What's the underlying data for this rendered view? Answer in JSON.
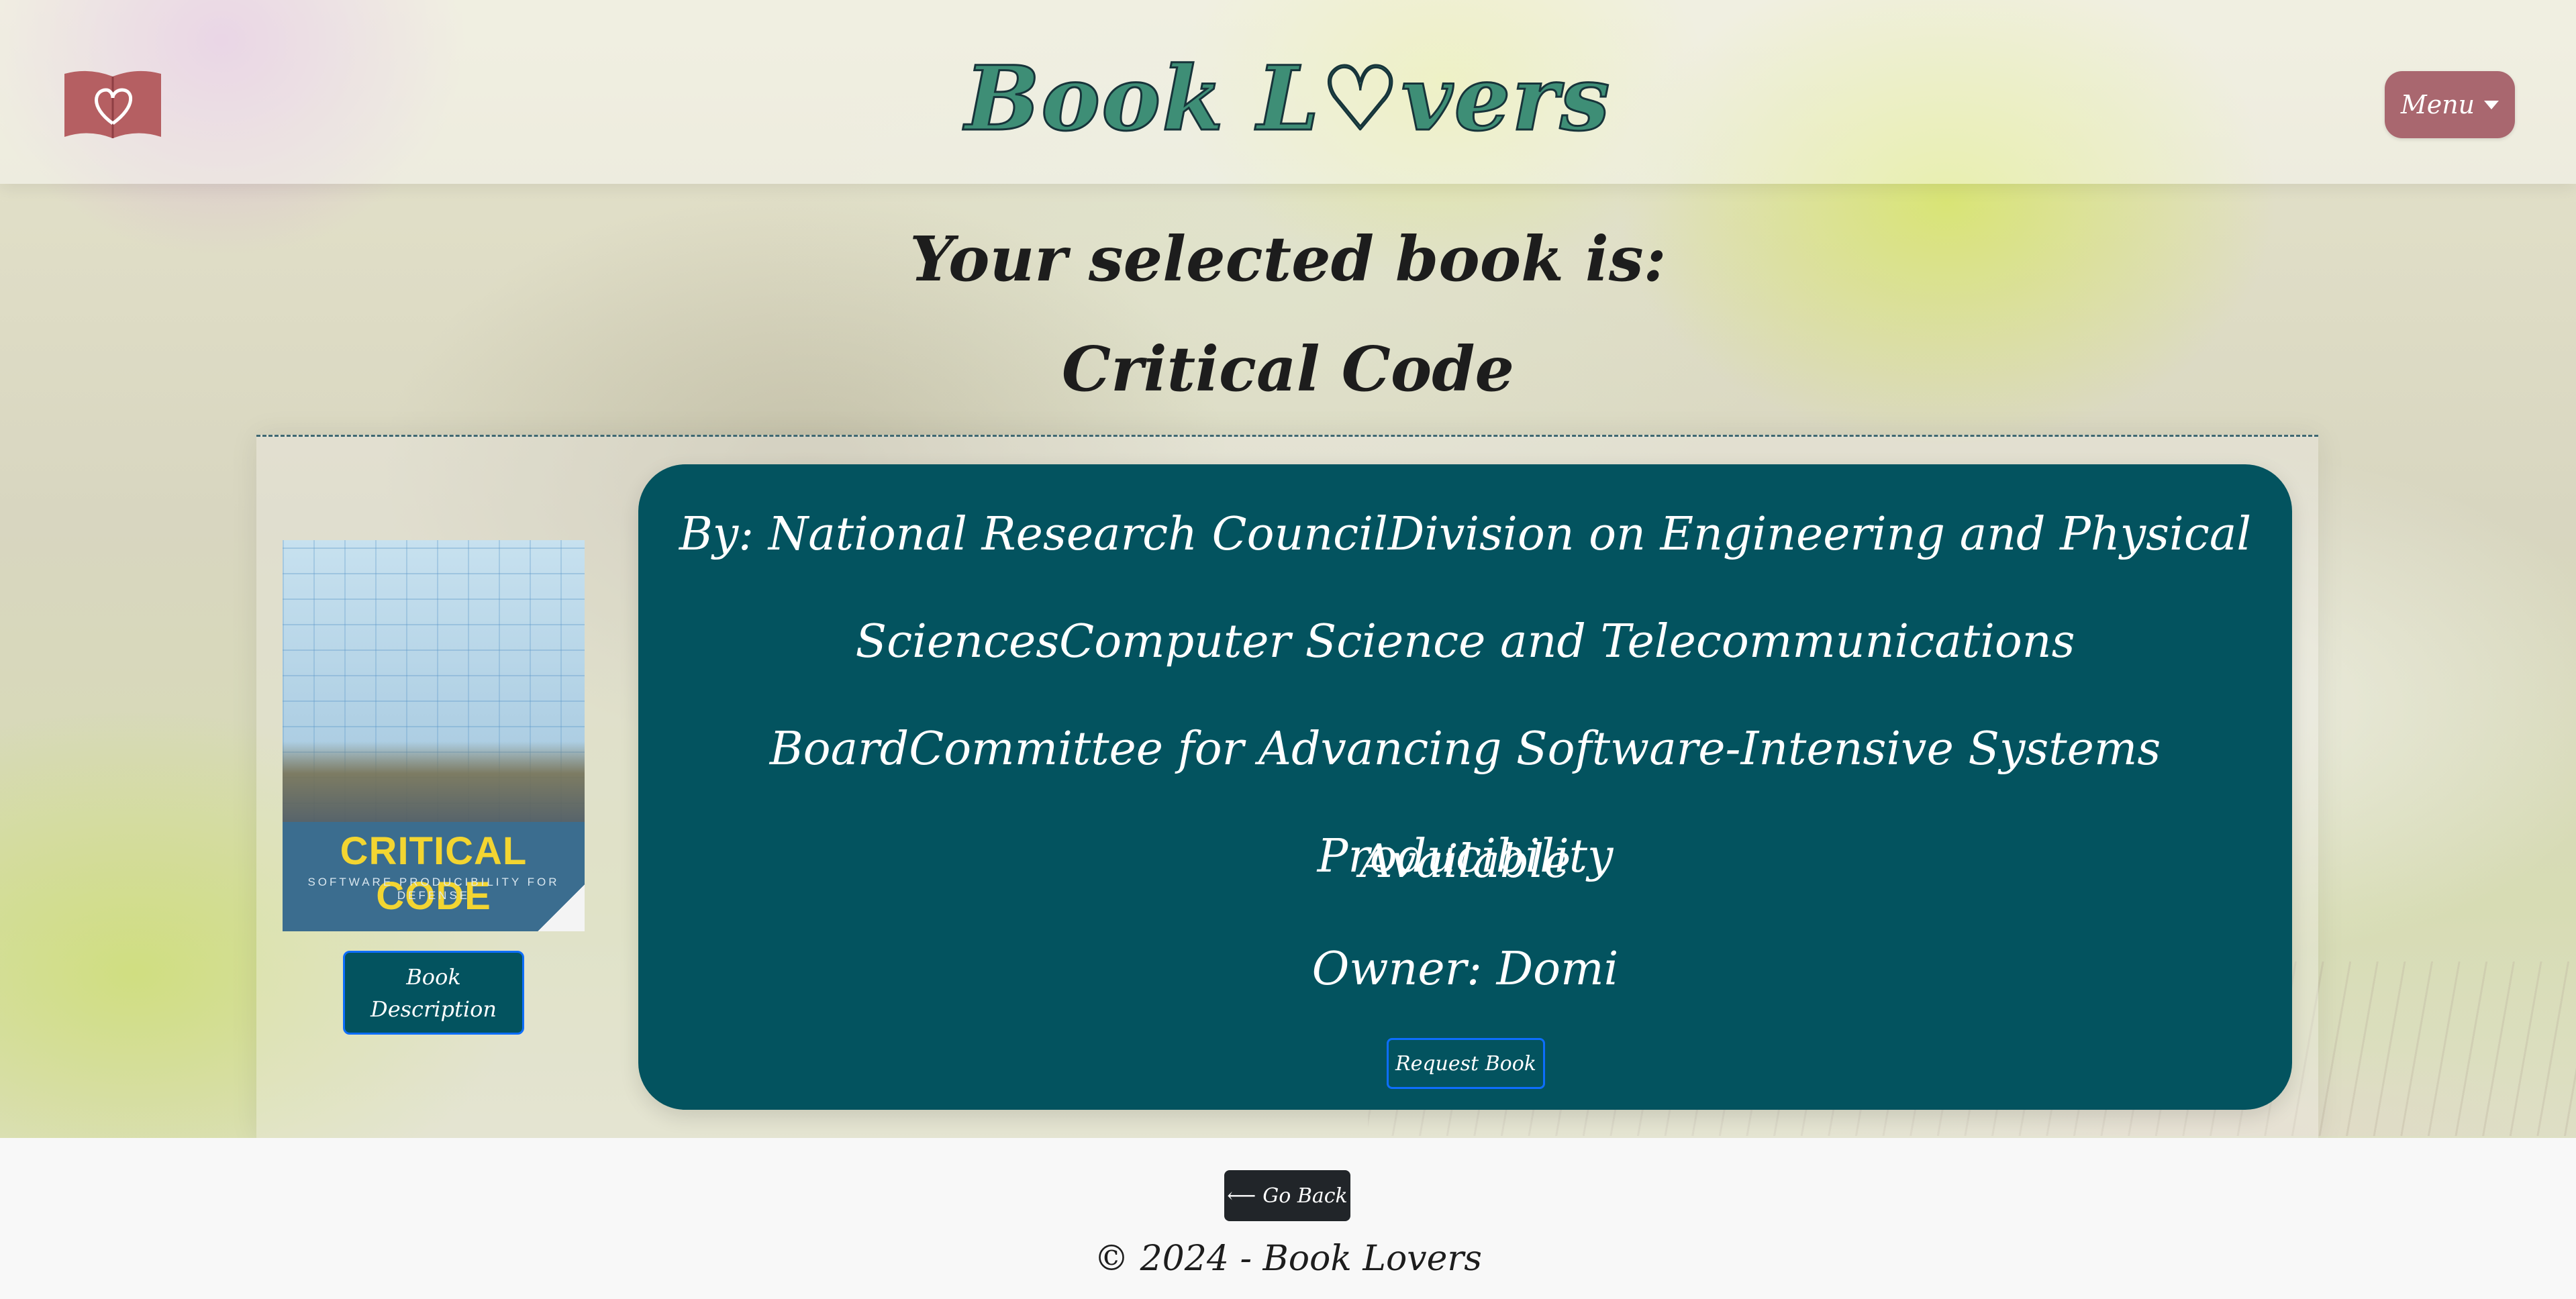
{
  "header": {
    "logo_icon": "open-book-heart-icon",
    "site_title": "Book L♡vers",
    "menu_label": "Menu",
    "menu_caret_icon": "caret-down-icon"
  },
  "selection": {
    "heading": "Your selected book is:",
    "title": "Critical Code"
  },
  "book": {
    "cover": {
      "title": "CRITICAL CODE",
      "subtitle": "SOFTWARE PRODUCIBILITY FOR DEFENSE"
    },
    "description_button": "Book Description",
    "author_line": "By: National Research CouncilDivision on Engineering and Physical SciencesComputer Science and Telecommunications BoardCommittee for Advancing Software-Intensive Systems Producibility",
    "availability": "Available",
    "owner_line": "Owner: Domi",
    "request_button": "Request Book"
  },
  "footer": {
    "back_button": "Go Back",
    "back_icon": "arrow-left-icon",
    "copyright": "© 2024 - Book Lovers"
  },
  "colors": {
    "brand_rose": "#a9676f",
    "panel_teal": "#03535f",
    "title_green": "#3e8e76",
    "button_border_blue": "#0d6efd",
    "dark_button": "#212529"
  }
}
